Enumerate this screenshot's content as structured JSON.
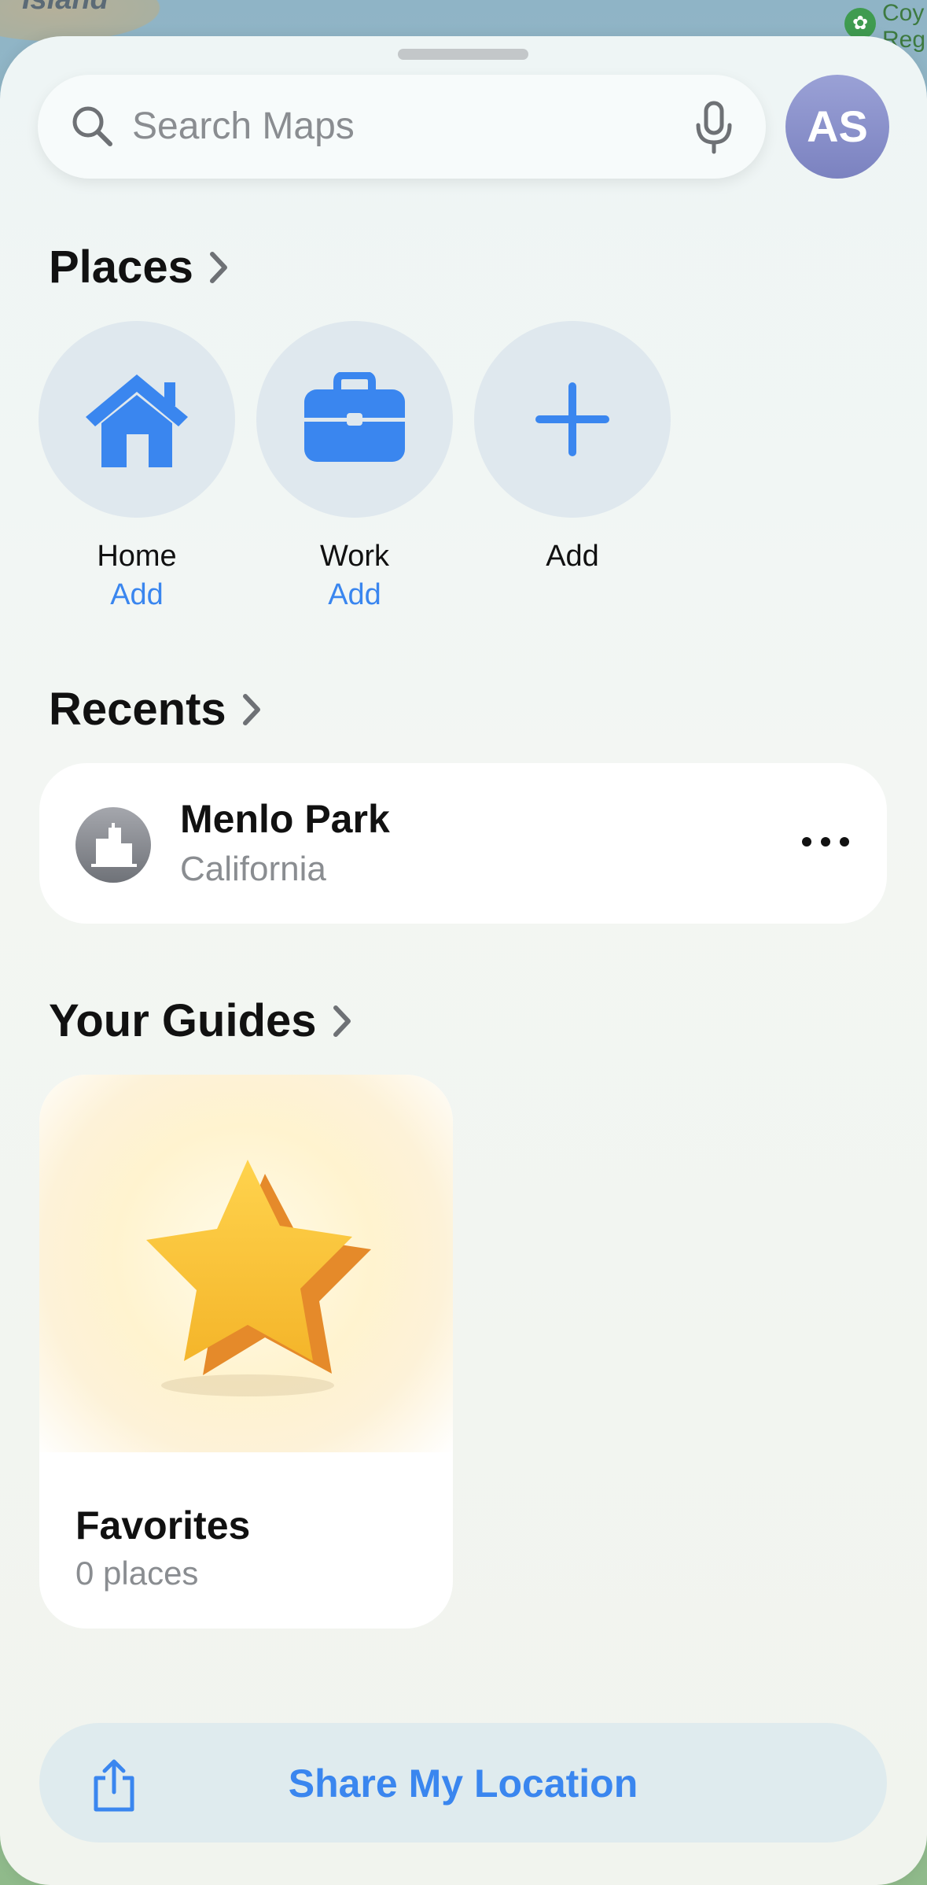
{
  "map": {
    "label_left": "Island",
    "label_right": "Coy\nReg",
    "park_icon": "tree-icon"
  },
  "search": {
    "placeholder": "Search Maps",
    "icon": "search-icon",
    "mic_icon": "microphone-icon"
  },
  "avatar": {
    "initials": "AS"
  },
  "places": {
    "title": "Places",
    "items": [
      {
        "name": "Home",
        "sub": "Add",
        "icon": "house-icon"
      },
      {
        "name": "Work",
        "sub": "Add",
        "icon": "briefcase-icon"
      },
      {
        "name": "Add",
        "sub": "",
        "icon": "plus-icon"
      }
    ]
  },
  "recents": {
    "title": "Recents",
    "items": [
      {
        "title": "Menlo Park",
        "subtitle": "California",
        "icon": "city-icon"
      }
    ]
  },
  "guides": {
    "title": "Your Guides",
    "items": [
      {
        "title": "Favorites",
        "subtitle": "0 places",
        "icon": "star-icon"
      }
    ]
  },
  "share": {
    "label": "Share My Location",
    "icon": "share-icon"
  },
  "colors": {
    "accent": "#3a86ef",
    "avatar": "#8a90cc",
    "place_circle": "#dfe8ee"
  }
}
